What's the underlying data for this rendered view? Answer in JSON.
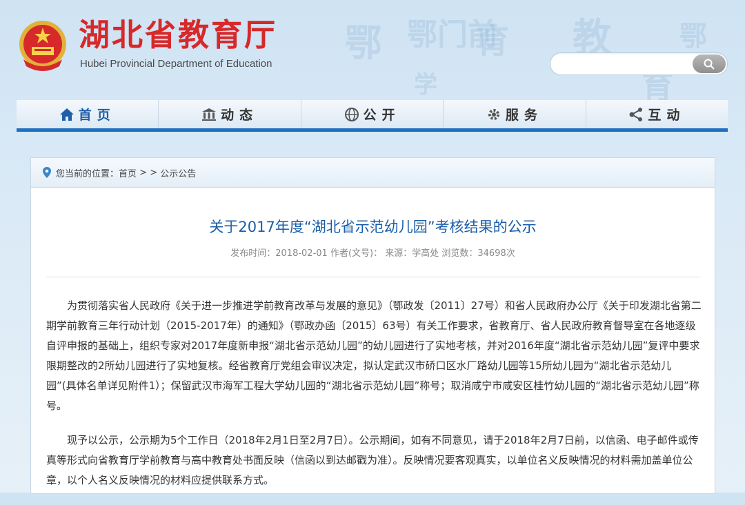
{
  "header": {
    "title_cn": "湖北省教育厅",
    "title_en": "Hubei Provincial Department of Education",
    "search_placeholder": ""
  },
  "nav": {
    "items": [
      {
        "label": "首页",
        "icon": "home-icon"
      },
      {
        "label": "动态",
        "icon": "building-icon"
      },
      {
        "label": "公开",
        "icon": "globe-icon"
      },
      {
        "label": "服务",
        "icon": "gear-icon"
      },
      {
        "label": "互动",
        "icon": "share-icon"
      }
    ]
  },
  "breadcrumb": {
    "prefix": "您当前的位置：",
    "home": "首页",
    "sep": " > > ",
    "current": "公示公告"
  },
  "article": {
    "title": "关于2017年度“湖北省示范幼儿园”考核结果的公示",
    "meta": "发布时间：2018-02-01 作者(文号)： 来源：学高处 浏览数：34698次",
    "paragraphs": [
      "为贯彻落实省人民政府《关于进一步推进学前教育改革与发展的意见》（鄂政发〔2011〕27号）和省人民政府办公厅《关于印发湖北省第二期学前教育三年行动计划（2015-2017年）的通知》（鄂政办函〔2015〕63号）有关工作要求，省教育厅、省人民政府教育督导室在各地逐级自评申报的基础上，组织专家对2017年度新申报“湖北省示范幼儿园”的幼儿园进行了实地考核，并对2016年度“湖北省示范幼儿园”复评中要求限期整改的2所幼儿园进行了实地复核。经省教育厅党组会审议决定，拟认定武汉市硚口区水厂路幼儿园等15所幼儿园为“湖北省示范幼儿园”(具体名单详见附件1）；保留武汉市海军工程大学幼儿园的“湖北省示范幼儿园”称号；取消咸宁市咸安区桂竹幼儿园的“湖北省示范幼儿园”称号。",
      "现予以公示，公示期为5个工作日（2018年2月1日至2月7日）。公示期间，如有不同意见，请于2018年2月7日前，以信函、电子邮件或传真等形式向省教育厅学前教育与高中教育处书面反映（信函以到达邮戳为准）。反映情况要客观真实，以单位名义反映情况的材料需加盖单位公章，以个人名义反映情况的材料应提供联系方式。"
    ]
  },
  "colors": {
    "title_red": "#d7282a",
    "nav_blue": "#1f6fbf",
    "article_title_blue": "#1a5ea8"
  }
}
